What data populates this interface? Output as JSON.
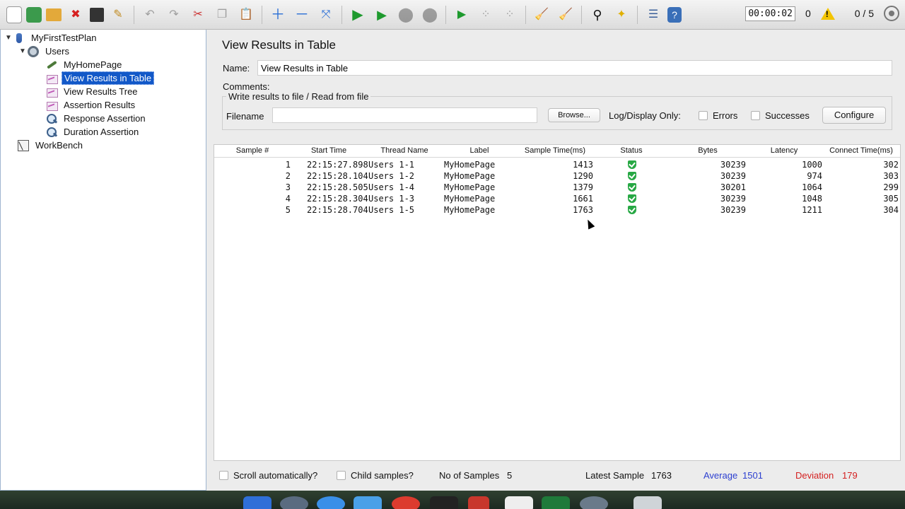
{
  "toolbar": {
    "icons": [
      "new-icon",
      "templates-icon",
      "open-icon",
      "close-icon",
      "save-icon",
      "save-as-icon",
      "undo-icon",
      "redo-icon",
      "cut-icon",
      "copy-icon",
      "paste-icon",
      "expand-icon",
      "collapse-icon",
      "toggle-icon",
      "start-icon",
      "start-no-pauses-icon",
      "stop-icon",
      "shutdown-icon",
      "remote-start-icon",
      "remote-stop-icon",
      "remote-shutdown-icon",
      "clear-icon",
      "clear-all-icon",
      "search-icon",
      "reset-search-icon",
      "function-helper-icon",
      "help-icon"
    ],
    "timer": "00:00:02",
    "errors": "0",
    "threads": "0 / 5"
  },
  "tree": {
    "plan": "MyFirstTestPlan",
    "group": "Users",
    "items": [
      "MyHomePage",
      "View Results in Table",
      "View Results Tree",
      "Assertion Results",
      "Response Assertion",
      "Duration Assertion"
    ],
    "workbench": "WorkBench",
    "selected_index": 1
  },
  "panel": {
    "title": "View Results in Table",
    "name_label": "Name:",
    "name_value": "View Results in Table",
    "comments_label": "Comments:",
    "file_group_title": "Write results to file / Read from file",
    "filename_label": "Filename",
    "browse_label": "Browse...",
    "log_label": "Log/Display Only:",
    "errors_label": "Errors",
    "successes_label": "Successes",
    "configure_label": "Configure"
  },
  "table": {
    "headers": [
      "Sample #",
      "Start Time",
      "Thread Name",
      "Label",
      "Sample Time(ms)",
      "Status",
      "Bytes",
      "Latency",
      "Connect Time(ms)"
    ],
    "rows": [
      {
        "sample": "1",
        "start": "22:15:27.898",
        "thread": "Users 1-1",
        "label": "MyHomePage",
        "time": "1413",
        "status": "success",
        "bytes": "30239",
        "latency": "1000",
        "connect": "302"
      },
      {
        "sample": "2",
        "start": "22:15:28.104",
        "thread": "Users 1-2",
        "label": "MyHomePage",
        "time": "1290",
        "status": "success",
        "bytes": "30239",
        "latency": "974",
        "connect": "303"
      },
      {
        "sample": "3",
        "start": "22:15:28.505",
        "thread": "Users 1-4",
        "label": "MyHomePage",
        "time": "1379",
        "status": "success",
        "bytes": "30201",
        "latency": "1064",
        "connect": "299"
      },
      {
        "sample": "4",
        "start": "22:15:28.304",
        "thread": "Users 1-3",
        "label": "MyHomePage",
        "time": "1661",
        "status": "success",
        "bytes": "30239",
        "latency": "1048",
        "connect": "305"
      },
      {
        "sample": "5",
        "start": "22:15:28.704",
        "thread": "Users 1-5",
        "label": "MyHomePage",
        "time": "1763",
        "status": "success",
        "bytes": "30239",
        "latency": "1211",
        "connect": "304"
      }
    ]
  },
  "footer": {
    "scroll_label": "Scroll automatically?",
    "child_label": "Child samples?",
    "samples_label": "No of Samples",
    "samples_value": "5",
    "latest_label": "Latest Sample",
    "latest_value": "1763",
    "average_label": "Average",
    "average_value": "1501",
    "deviation_label": "Deviation",
    "deviation_value": "179"
  },
  "colors": {
    "selection": "#1258c8",
    "average": "#2c3fd0",
    "deviation": "#d42020",
    "success": "#27a844"
  }
}
